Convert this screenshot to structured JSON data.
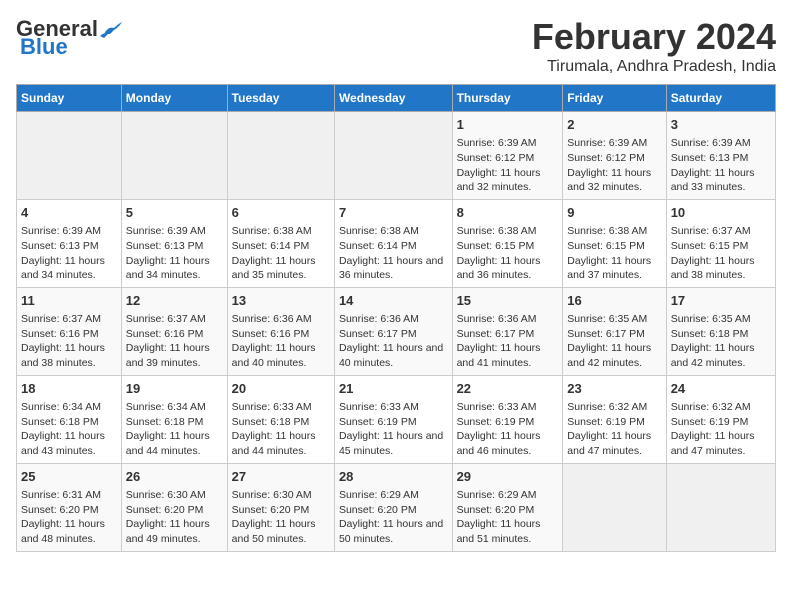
{
  "logo": {
    "line1": "General",
    "line2": "Blue"
  },
  "title": "February 2024",
  "subtitle": "Tirumala, Andhra Pradesh, India",
  "days_of_week": [
    "Sunday",
    "Monday",
    "Tuesday",
    "Wednesday",
    "Thursday",
    "Friday",
    "Saturday"
  ],
  "weeks": [
    [
      {
        "day": "",
        "info": ""
      },
      {
        "day": "",
        "info": ""
      },
      {
        "day": "",
        "info": ""
      },
      {
        "day": "",
        "info": ""
      },
      {
        "day": "1",
        "info": "Sunrise: 6:39 AM\nSunset: 6:12 PM\nDaylight: 11 hours and 32 minutes."
      },
      {
        "day": "2",
        "info": "Sunrise: 6:39 AM\nSunset: 6:12 PM\nDaylight: 11 hours and 32 minutes."
      },
      {
        "day": "3",
        "info": "Sunrise: 6:39 AM\nSunset: 6:13 PM\nDaylight: 11 hours and 33 minutes."
      }
    ],
    [
      {
        "day": "4",
        "info": "Sunrise: 6:39 AM\nSunset: 6:13 PM\nDaylight: 11 hours and 34 minutes."
      },
      {
        "day": "5",
        "info": "Sunrise: 6:39 AM\nSunset: 6:13 PM\nDaylight: 11 hours and 34 minutes."
      },
      {
        "day": "6",
        "info": "Sunrise: 6:38 AM\nSunset: 6:14 PM\nDaylight: 11 hours and 35 minutes."
      },
      {
        "day": "7",
        "info": "Sunrise: 6:38 AM\nSunset: 6:14 PM\nDaylight: 11 hours and 36 minutes."
      },
      {
        "day": "8",
        "info": "Sunrise: 6:38 AM\nSunset: 6:15 PM\nDaylight: 11 hours and 36 minutes."
      },
      {
        "day": "9",
        "info": "Sunrise: 6:38 AM\nSunset: 6:15 PM\nDaylight: 11 hours and 37 minutes."
      },
      {
        "day": "10",
        "info": "Sunrise: 6:37 AM\nSunset: 6:15 PM\nDaylight: 11 hours and 38 minutes."
      }
    ],
    [
      {
        "day": "11",
        "info": "Sunrise: 6:37 AM\nSunset: 6:16 PM\nDaylight: 11 hours and 38 minutes."
      },
      {
        "day": "12",
        "info": "Sunrise: 6:37 AM\nSunset: 6:16 PM\nDaylight: 11 hours and 39 minutes."
      },
      {
        "day": "13",
        "info": "Sunrise: 6:36 AM\nSunset: 6:16 PM\nDaylight: 11 hours and 40 minutes."
      },
      {
        "day": "14",
        "info": "Sunrise: 6:36 AM\nSunset: 6:17 PM\nDaylight: 11 hours and 40 minutes."
      },
      {
        "day": "15",
        "info": "Sunrise: 6:36 AM\nSunset: 6:17 PM\nDaylight: 11 hours and 41 minutes."
      },
      {
        "day": "16",
        "info": "Sunrise: 6:35 AM\nSunset: 6:17 PM\nDaylight: 11 hours and 42 minutes."
      },
      {
        "day": "17",
        "info": "Sunrise: 6:35 AM\nSunset: 6:18 PM\nDaylight: 11 hours and 42 minutes."
      }
    ],
    [
      {
        "day": "18",
        "info": "Sunrise: 6:34 AM\nSunset: 6:18 PM\nDaylight: 11 hours and 43 minutes."
      },
      {
        "day": "19",
        "info": "Sunrise: 6:34 AM\nSunset: 6:18 PM\nDaylight: 11 hours and 44 minutes."
      },
      {
        "day": "20",
        "info": "Sunrise: 6:33 AM\nSunset: 6:18 PM\nDaylight: 11 hours and 44 minutes."
      },
      {
        "day": "21",
        "info": "Sunrise: 6:33 AM\nSunset: 6:19 PM\nDaylight: 11 hours and 45 minutes."
      },
      {
        "day": "22",
        "info": "Sunrise: 6:33 AM\nSunset: 6:19 PM\nDaylight: 11 hours and 46 minutes."
      },
      {
        "day": "23",
        "info": "Sunrise: 6:32 AM\nSunset: 6:19 PM\nDaylight: 11 hours and 47 minutes."
      },
      {
        "day": "24",
        "info": "Sunrise: 6:32 AM\nSunset: 6:19 PM\nDaylight: 11 hours and 47 minutes."
      }
    ],
    [
      {
        "day": "25",
        "info": "Sunrise: 6:31 AM\nSunset: 6:20 PM\nDaylight: 11 hours and 48 minutes."
      },
      {
        "day": "26",
        "info": "Sunrise: 6:30 AM\nSunset: 6:20 PM\nDaylight: 11 hours and 49 minutes."
      },
      {
        "day": "27",
        "info": "Sunrise: 6:30 AM\nSunset: 6:20 PM\nDaylight: 11 hours and 50 minutes."
      },
      {
        "day": "28",
        "info": "Sunrise: 6:29 AM\nSunset: 6:20 PM\nDaylight: 11 hours and 50 minutes."
      },
      {
        "day": "29",
        "info": "Sunrise: 6:29 AM\nSunset: 6:20 PM\nDaylight: 11 hours and 51 minutes."
      },
      {
        "day": "",
        "info": ""
      },
      {
        "day": "",
        "info": ""
      }
    ]
  ]
}
